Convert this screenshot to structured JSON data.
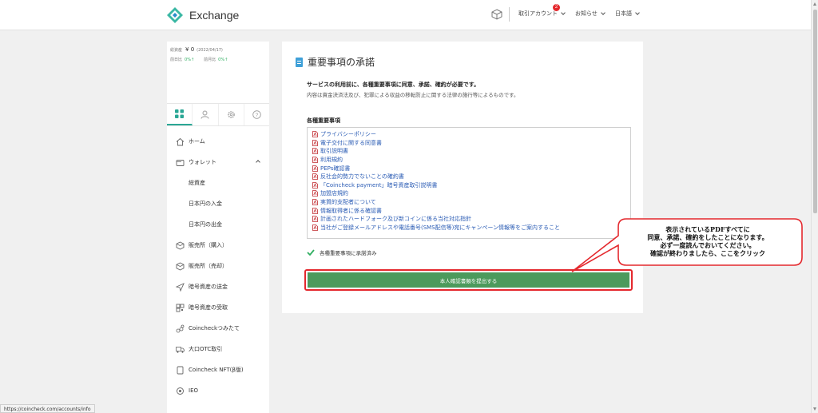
{
  "header": {
    "logo_text": "Exchange",
    "account_menu": "取引アカウント",
    "account_badge": "2",
    "news_menu": "お知らせ",
    "language_menu": "日本語"
  },
  "sidebar": {
    "total_assets_label": "総資産",
    "total_assets_value": "¥ 0",
    "total_assets_date": "(2022/04/17)",
    "prev_day_label": "前日比",
    "prev_day_value": "0%↑",
    "prev_month_label": "前月比",
    "prev_month_value": "0%↑",
    "items": [
      {
        "label": "ホーム",
        "icon": "home-icon"
      },
      {
        "label": "ウォレット",
        "icon": "wallet-icon"
      },
      {
        "label": "総資産",
        "icon": ""
      },
      {
        "label": "日本円の入金",
        "icon": ""
      },
      {
        "label": "日本円の出金",
        "icon": ""
      },
      {
        "label": "販売所（購入）",
        "icon": "cube-icon"
      },
      {
        "label": "販売所（売却）",
        "icon": "cube-icon"
      },
      {
        "label": "暗号資産の送金",
        "icon": "send-icon"
      },
      {
        "label": "暗号資産の受取",
        "icon": "qr-icon"
      },
      {
        "label": "Coincheckつみたて",
        "icon": "coins-icon"
      },
      {
        "label": "大口OTC取引",
        "icon": "truck-icon"
      },
      {
        "label": "Coincheck NFT(β版)",
        "icon": "nft-icon"
      },
      {
        "label": "IEO",
        "icon": "ieo-icon"
      }
    ]
  },
  "main": {
    "title": "重要事項の承諾",
    "intro_bold": "サービスの利用前に、各種重要事項に同意、承諾、確約が必要です。",
    "intro_text": "内容は資金決済法及び、犯罪による収益の移転防止に関する法律の施行等によるものです。",
    "list_heading": "各種重要事項",
    "documents": [
      "プライバシーポリシー",
      "電子交付に関する同意書",
      "取引説明書",
      "利用規約",
      "PEPs確認書",
      "反社会的勢力でないことの確約書",
      "「Coincheck payment」暗号資産取引説明書",
      "加盟店規約",
      "実質的支配者について",
      "情報取得者に係る確認書",
      "計画されたハードフォーク及び新コインに係る当社対応指針",
      "当社がご登録メールアドレスや電話番号(SMS配信等)宛にキャンペーン情報等をご案内すること"
    ],
    "agree_text": "各種重要事項に承諾済み",
    "submit_label": "本人確認書類を提出する"
  },
  "callout": {
    "line1": "表示されているPDFすべてに",
    "line2": "同意、承諾、確約をしたことになります。",
    "line3": "必ず一度読んでおいてください。",
    "line4": "確認が終わりましたら、ここをクリック"
  },
  "status_bar": {
    "url": "https://coincheck.com/accounts/info"
  },
  "colors": {
    "accent": "#2aa795",
    "button": "#4c9a5c",
    "link": "#2c5db5",
    "annotation": "#e4282d"
  }
}
